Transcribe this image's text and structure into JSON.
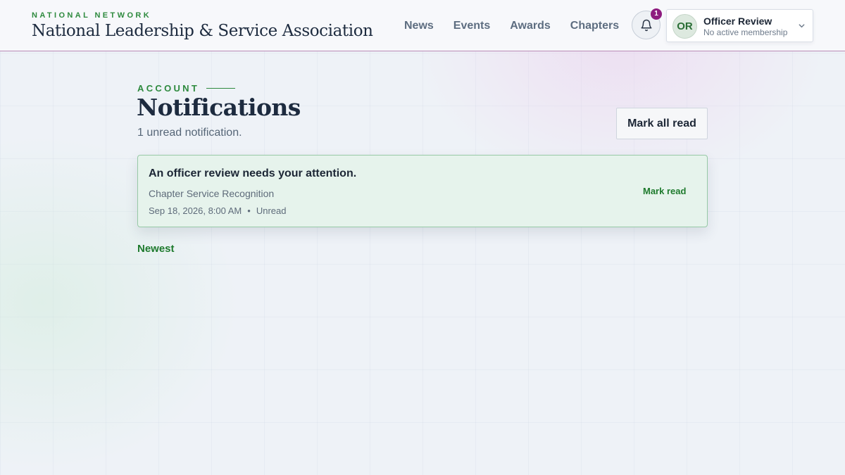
{
  "header": {
    "eyebrow": "NATIONAL NETWORK",
    "org_name": "National Leadership & Service Association",
    "nav": [
      "News",
      "Events",
      "Awards",
      "Chapters"
    ],
    "notification_count": "1",
    "user": {
      "initials": "OR",
      "name": "Officer Review",
      "status": "No active membership"
    }
  },
  "page": {
    "eyebrow": "ACCOUNT",
    "title": "Notifications",
    "subtitle": "1 unread notification.",
    "mark_all_label": "Mark all read"
  },
  "notifications": [
    {
      "title": "An officer review needs your attention.",
      "context": "Chapter Service Recognition",
      "date": "Sep 18, 2026, 8:00 AM",
      "separator": "•",
      "status": "Unread",
      "action_label": "Mark read"
    }
  ],
  "sort_label": "Newest",
  "icons": {
    "bell": "bell-icon",
    "chevron": "chevron-down-icon"
  },
  "colors": {
    "accent_green": "#2e8a3e",
    "badge_purple": "#8e1b7f",
    "navy": "#1d2b3f"
  }
}
